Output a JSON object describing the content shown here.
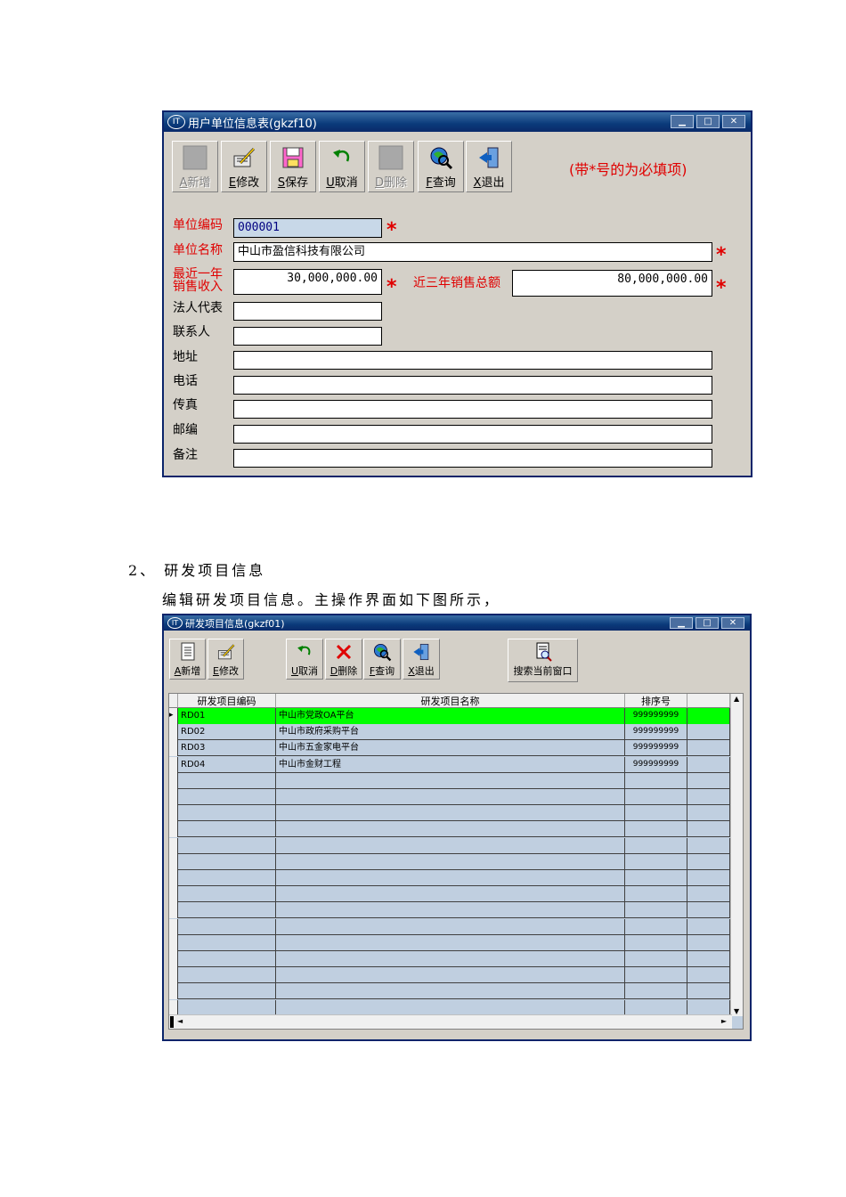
{
  "window1": {
    "title": "用户单位信息表(gkzf10)",
    "toolbar": [
      {
        "hotkey": "A",
        "label": "新增",
        "enabled": false,
        "icon": "blank-icon"
      },
      {
        "hotkey": "E",
        "label": "修改",
        "enabled": true,
        "icon": "edit-icon"
      },
      {
        "hotkey": "S",
        "label": "保存",
        "enabled": true,
        "icon": "save-icon"
      },
      {
        "hotkey": "U",
        "label": "取消",
        "enabled": true,
        "icon": "undo-icon"
      },
      {
        "hotkey": "D",
        "label": "删除",
        "enabled": false,
        "icon": "blank-icon"
      },
      {
        "hotkey": "F",
        "label": "查询",
        "enabled": true,
        "icon": "search-icon"
      },
      {
        "hotkey": "X",
        "label": "退出",
        "enabled": true,
        "icon": "exit-icon"
      }
    ],
    "required_note": "(带*号的为必填项)",
    "star": "*",
    "fields": {
      "code_label": "单位编码",
      "code_value": "000001",
      "name_label": "单位名称",
      "name_value": "中山市盈信科技有限公司",
      "income_label_1": "最近一年",
      "income_label_2": "销售收入",
      "income_value": "30,000,000.00",
      "total_label": "近三年销售总额",
      "total_value": "80,000,000.00",
      "legal_label": "法人代表",
      "legal_value": "",
      "contact_label": "联系人",
      "contact_value": "",
      "address_label": "地址",
      "address_value": "",
      "phone_label": "电话",
      "phone_value": "",
      "fax_label": "传真",
      "fax_value": "",
      "zip_label": "邮编",
      "zip_value": "",
      "remark_label": "备注",
      "remark_value": ""
    }
  },
  "doc": {
    "heading": "2、 研发项目信息",
    "paragraph": "编辑研发项目信息。主操作界面如下图所示，"
  },
  "window2": {
    "title": "研发项目信息(gkzf01)",
    "toolbar_left": [
      {
        "hotkey": "A",
        "label": "新增",
        "icon": "new-doc-icon"
      },
      {
        "hotkey": "E",
        "label": "修改",
        "icon": "edit-icon"
      }
    ],
    "toolbar_mid": [
      {
        "hotkey": "U",
        "label": "取消",
        "icon": "undo-icon"
      },
      {
        "hotkey": "D",
        "label": "删除",
        "icon": "delete-icon"
      },
      {
        "hotkey": "F",
        "label": "查询",
        "icon": "search-icon"
      },
      {
        "hotkey": "X",
        "label": "退出",
        "icon": "exit-icon"
      }
    ],
    "search_window_label": "搜索当前窗口",
    "columns": [
      "研发项目编码",
      "研发项目名称",
      "排序号"
    ],
    "rows": [
      [
        "RD01",
        "中山市党政OA平台",
        "999999999"
      ],
      [
        "RD02",
        "中山市政府采购平台",
        "999999999"
      ],
      [
        "RD03",
        "中山市五金家电平台",
        "999999999"
      ],
      [
        "RD04",
        "中山市金财工程",
        "999999999"
      ]
    ],
    "selected_row": 0,
    "colors": {
      "selected": "#00ff00",
      "grid_bg": "#c0cfe0"
    }
  }
}
